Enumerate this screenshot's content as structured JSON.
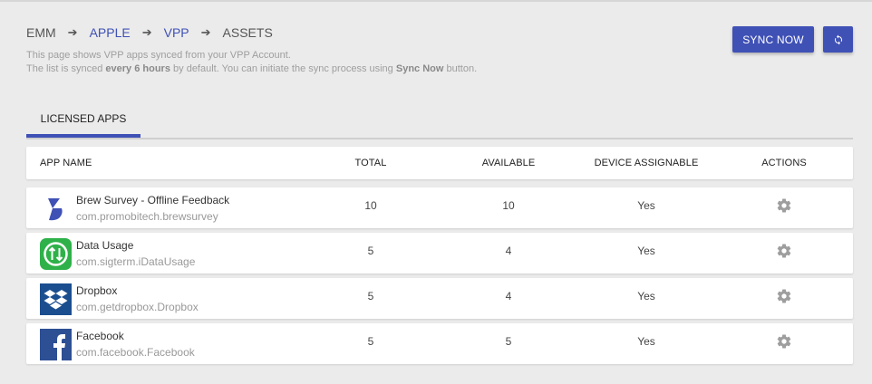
{
  "breadcrumb": [
    {
      "label": "EMM",
      "link": false
    },
    {
      "label": "APPLE",
      "link": true
    },
    {
      "label": "VPP",
      "link": true
    },
    {
      "label": "ASSETS",
      "link": false
    }
  ],
  "arrow": "➔",
  "description": {
    "line1": "This page shows VPP apps synced from your VPP Account.",
    "line2_pre": "The list is synced ",
    "line2_bold1": "every 6 hours",
    "line2_mid": " by default. You can initiate the sync process using ",
    "line2_bold2": "Sync Now",
    "line2_post": " button."
  },
  "buttons": {
    "sync_now": "SYNC NOW",
    "refresh_icon": "refresh-icon"
  },
  "tabs": [
    {
      "label": "LICENSED APPS",
      "active": true
    }
  ],
  "table": {
    "headers": {
      "app_name": "APP NAME",
      "total": "TOTAL",
      "available": "AVAILABLE",
      "device_assignable": "DEVICE ASSIGNABLE",
      "actions": "ACTIONS"
    },
    "rows": [
      {
        "name": "Brew Survey - Offline Feedback",
        "bundle": "com.promobitech.brewsurvey",
        "total": "10",
        "available": "10",
        "assignable": "Yes",
        "icon": "brew-survey-icon"
      },
      {
        "name": "Data Usage",
        "bundle": "com.sigterm.iDataUsage",
        "total": "5",
        "available": "4",
        "assignable": "Yes",
        "icon": "data-usage-icon"
      },
      {
        "name": "Dropbox",
        "bundle": "com.getdropbox.Dropbox",
        "total": "5",
        "available": "4",
        "assignable": "Yes",
        "icon": "dropbox-icon"
      },
      {
        "name": "Facebook",
        "bundle": "com.facebook.Facebook",
        "total": "5",
        "available": "5",
        "assignable": "Yes",
        "icon": "facebook-icon"
      }
    ]
  },
  "colors": {
    "accent": "#3f51b5",
    "background": "#ebebeb"
  }
}
